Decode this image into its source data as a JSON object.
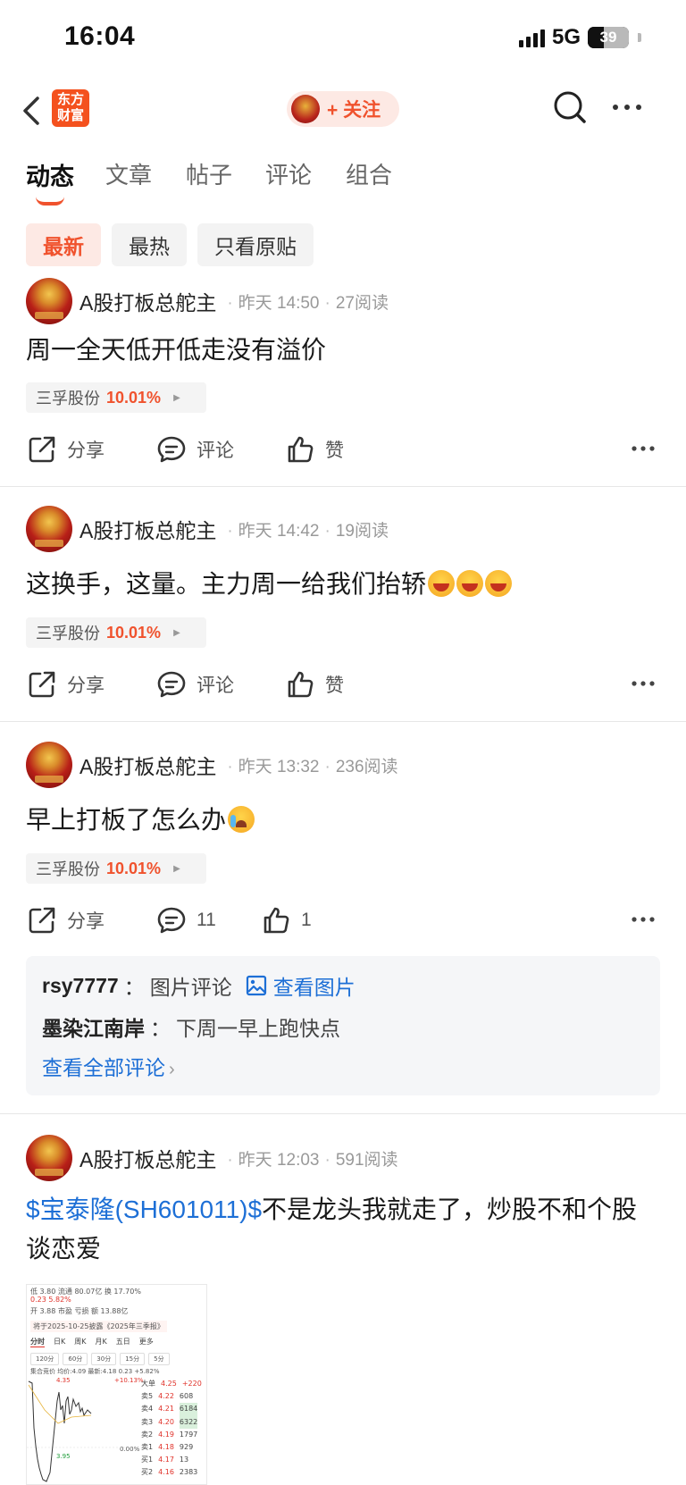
{
  "status_bar": {
    "time": "16:04",
    "network": "5G",
    "battery": "39"
  },
  "navbar": {
    "brand_line1": "东方",
    "brand_line2": "财富",
    "follow_label": "+ 关注"
  },
  "tabs": [
    "动态",
    "文章",
    "帖子",
    "评论",
    "组合"
  ],
  "filters": [
    "最新",
    "最热",
    "只看原贴"
  ],
  "posts": [
    {
      "author": "A股打板总舵主",
      "time": "昨天 14:50",
      "reads": "27阅读",
      "text": "周一全天低开低走没有溢价",
      "stock_name": "三孚股份",
      "stock_pct": "10.01%",
      "share": "分享",
      "comment": "评论",
      "like": "赞"
    },
    {
      "author": "A股打板总舵主",
      "time": "昨天 14:42",
      "reads": "19阅读",
      "text": "这换手，这量。主力周一给我们抬轿",
      "stock_name": "三孚股份",
      "stock_pct": "10.01%",
      "share": "分享",
      "comment": "评论",
      "like": "赞"
    },
    {
      "author": "A股打板总舵主",
      "time": "昨天 13:32",
      "reads": "236阅读",
      "text": "早上打板了怎么办",
      "stock_name": "三孚股份",
      "stock_pct": "10.01%",
      "share": "分享",
      "comment": "11",
      "like": "1",
      "comments": [
        {
          "user": "rsy7777",
          "text": "图片评论",
          "link": "查看图片"
        },
        {
          "user": "墨染江南岸",
          "text": "下周一早上跑快点"
        }
      ],
      "view_all": "查看全部评论"
    },
    {
      "author": "A股打板总舵主",
      "time": "昨天 12:03",
      "reads": "591阅读",
      "text_link": "$宝泰隆(SH601011)$",
      "text": "不是龙头我就走了，炒股不和个股谈恋爱"
    }
  ],
  "thumbnail": {
    "row1": "低    3.80  流通 80.07亿  换  17.70%",
    "row2": "0.23  5.82%",
    "row3": "开    3.88  市盈   亏损   额  13.88亿",
    "notice": "将于2025-10-25披露《2025年三季报》",
    "tabs": [
      "分时",
      "日K",
      "周K",
      "月K",
      "五日",
      "更多"
    ],
    "subtabs": [
      "120分",
      "60分",
      "30分",
      "15分",
      "5分"
    ],
    "legend": "集合竞价   均价:4.09  最新:4.18  0.23  +5.82%",
    "price_top": "4.35",
    "pct_top": "+10.13%",
    "price_low": "3.95",
    "pct_zero": "0.00%",
    "order_book": [
      {
        "label": "大单",
        "price": "4.25",
        "vol": "+220"
      },
      {
        "label": "卖5",
        "price": "4.22",
        "vol": "608"
      },
      {
        "label": "卖4",
        "price": "4.21",
        "vol": "6184"
      },
      {
        "label": "卖3",
        "price": "4.20",
        "vol": "6322"
      },
      {
        "label": "卖2",
        "price": "4.19",
        "vol": "1797"
      },
      {
        "label": "卖1",
        "price": "4.18",
        "vol": "929"
      },
      {
        "label": "买1",
        "price": "4.17",
        "vol": "13"
      },
      {
        "label": "买2",
        "price": "4.16",
        "vol": "2383"
      }
    ]
  },
  "colors": {
    "accent": "#f0522d",
    "link": "#1d6fd6",
    "pill_bg": "#fde9e4"
  },
  "icons": [
    "back-icon",
    "search-icon",
    "more-icon",
    "share-icon",
    "comment-icon",
    "like-icon",
    "image-icon"
  ]
}
